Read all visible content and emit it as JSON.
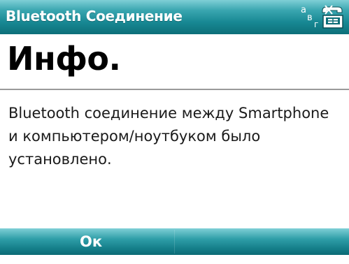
{
  "titlebar": {
    "title": "Bluetooth Соединение",
    "input_mode": {
      "a": "а",
      "b": "в",
      "c": "г"
    },
    "network_icon": "phone-network-icon"
  },
  "heading": "Инфо.",
  "message": "Bluetooth соединение между Smartphone и компьютером/ноутбуком было установлено.",
  "softkeys": {
    "left": "Ок"
  },
  "colors": {
    "bar_light": "#7fcfd6",
    "bar_dark": "#0d6f79",
    "text": "#1a1a1a",
    "background": "#ffffff"
  }
}
